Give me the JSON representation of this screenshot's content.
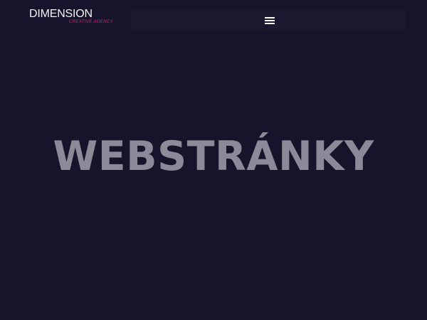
{
  "header": {
    "logo": {
      "title": "DIMENSION",
      "subtitle": "CREATIVE AGENCY"
    },
    "menu_icon": "hamburger-menu-icon"
  },
  "hero": {
    "title": "WEBSTRÁNKY"
  },
  "colors": {
    "background": "#16132a",
    "logo_text": "#f2f2f5",
    "logo_accent": "#d2207a",
    "hero_text": "#8c8a98"
  }
}
